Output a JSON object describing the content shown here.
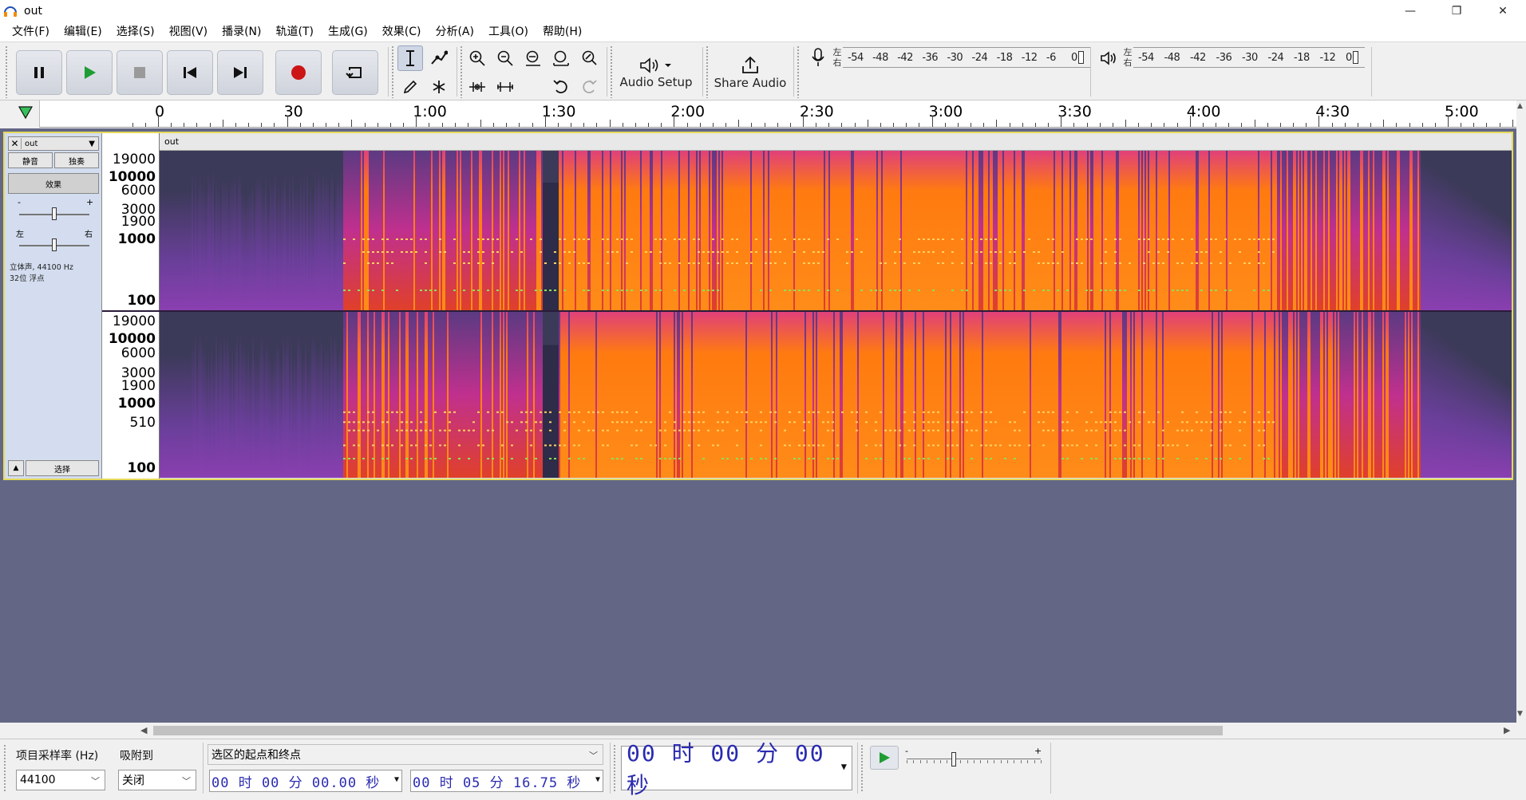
{
  "window": {
    "title": "out",
    "controls": [
      "—",
      "❐",
      "✕"
    ]
  },
  "menu": [
    "文件(F)",
    "编辑(E)",
    "选择(S)",
    "视图(V)",
    "播录(N)",
    "轨道(T)",
    "生成(G)",
    "效果(C)",
    "分析(A)",
    "工具(O)",
    "帮助(H)"
  ],
  "toolbar": {
    "transport": [
      "pause",
      "play",
      "stop",
      "skip-start",
      "skip-end",
      "record",
      "loop"
    ],
    "audio_setup_label": "Audio Setup",
    "share_audio_label": "Share Audio",
    "record_meter": {
      "lr": [
        "左",
        "右"
      ],
      "scale": [
        "-54",
        "-48",
        "-42",
        "-36",
        "-30",
        "-24",
        "-18",
        "-12",
        "-6",
        "0"
      ]
    },
    "playback_meter": {
      "lr": [
        "左",
        "右"
      ],
      "scale": [
        "-54",
        "-48",
        "-42",
        "-36",
        "-30",
        "-24",
        "-18",
        "-12",
        "0"
      ]
    }
  },
  "ruler": {
    "labels": [
      "0",
      "30",
      "1:00",
      "1:30",
      "2:00",
      "2:30",
      "3:00",
      "3:30",
      "4:00",
      "4:30",
      "5:00"
    ]
  },
  "track": {
    "name": "out",
    "header_name": "out",
    "mute_label": "静音",
    "solo_label": "独奏",
    "effects_label": "效果",
    "gain_minus": "-",
    "gain_plus": "+",
    "pan_left": "左",
    "pan_right": "右",
    "info_line1": "立体声, 44100 Hz",
    "info_line2": "32位 浮点",
    "select_label": "选择",
    "gain_value": 0.5,
    "pan_value": 0.5,
    "scale_ch1": [
      "19000",
      "10000",
      "6000",
      "3000",
      "1900",
      "1000",
      "100"
    ],
    "scale_ch2": [
      "19000",
      "10000",
      "6000",
      "3000",
      "1900",
      "1000",
      "510",
      "100"
    ]
  },
  "selection_bar": {
    "rate_label": "项目采样率 (Hz)",
    "snap_label": "吸附到",
    "rate_value": "44100",
    "snap_value": "关闭",
    "selection_mode": "选区的起点和终点",
    "start_time": "00 时 00 分 00.00 秒",
    "end_time": "00 时 05 分 16.75 秒",
    "position_time": "00 时 00 分 00 秒",
    "play_speed": 0.35
  },
  "colors": {
    "track_bg": "#636785",
    "selected_border": "#e5d95a",
    "time_text": "#2a2ab0",
    "spec_low": "#3b3a58",
    "spec_mid": "#c0308e",
    "spec_high": "#ff7a10"
  }
}
